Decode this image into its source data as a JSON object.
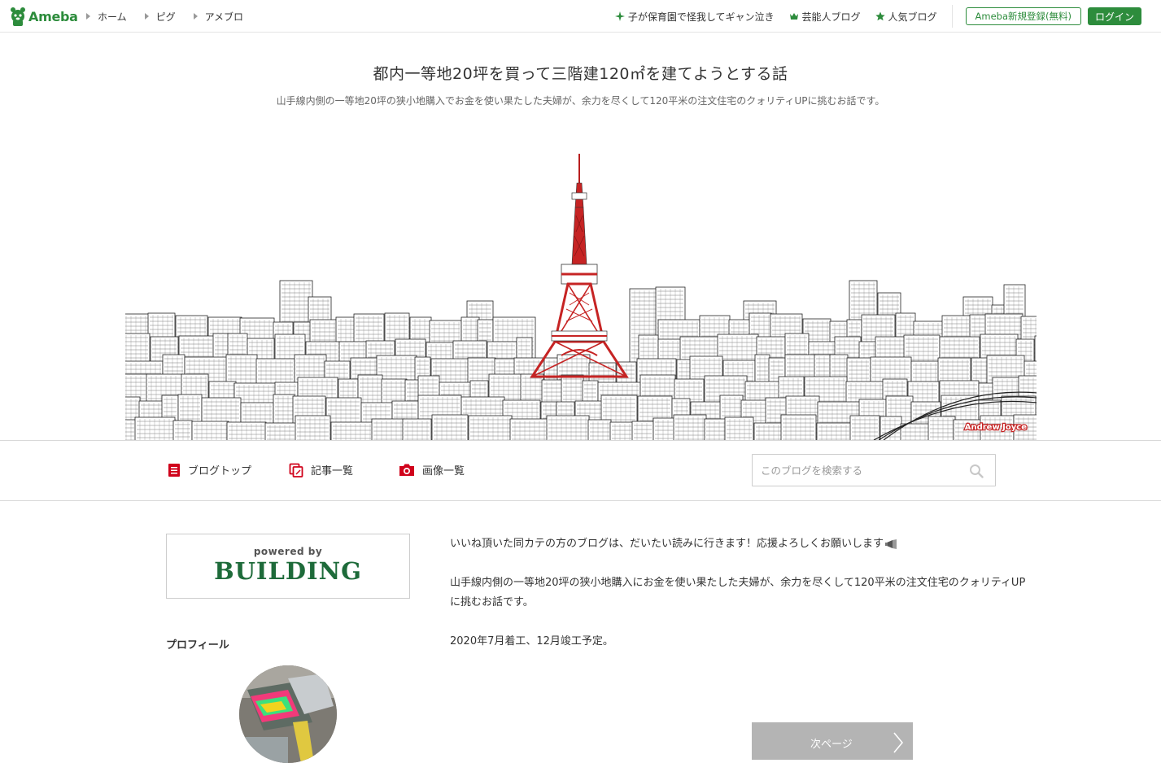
{
  "global_nav": {
    "logo_text": "Ameba",
    "links": [
      {
        "label": "ホーム"
      },
      {
        "label": "ピグ"
      },
      {
        "label": "アメブロ"
      }
    ],
    "trending": [
      {
        "label": "子が保育園で怪我してギャン泣き",
        "icon": "sparkle-icon"
      },
      {
        "label": "芸能人ブログ",
        "icon": "crown-icon"
      },
      {
        "label": "人気ブログ",
        "icon": "star-icon"
      }
    ],
    "register_label": "Ameba新規登録(無料)",
    "login_label": "ログイン"
  },
  "blog_header": {
    "title": "都内一等地20坪を買って三階建120㎡を建てようとする話",
    "description": "山手線内側の一等地20坪の狭小地購入でお金を使い果たした夫婦が、余力を尽くして120平米の注文住宅のクォリティUPに挑むお話です。",
    "image_credit": "Andrew Joyce"
  },
  "blog_menu": {
    "items": [
      {
        "label": "ブログトップ",
        "icon": "document-icon"
      },
      {
        "label": "記事一覧",
        "icon": "copy-icon"
      },
      {
        "label": "画像一覧",
        "icon": "camera-icon"
      }
    ],
    "search_placeholder": "このブログを検索する"
  },
  "sidebar": {
    "banner_powered": "powered by",
    "banner_brand": "BUILDING",
    "profile_heading": "プロフィール"
  },
  "main": {
    "paragraphs": [
      "いいね頂いた同カテの方のブログは、だいたい読みに行きます！応援よろしくお願いします",
      "山手線内側の一等地20坪の狭小地購入にお金を使い果たした夫婦が、余力を尽くして120平米の注文住宅のクォリティUPに挑むお話です。",
      "2020年7月着工、12月竣工予定。"
    ],
    "next_page_label": "次ページ"
  },
  "colors": {
    "brand_green": "#2d8c3c",
    "menu_red": "#d0021b",
    "tower_red": "#c62424"
  }
}
